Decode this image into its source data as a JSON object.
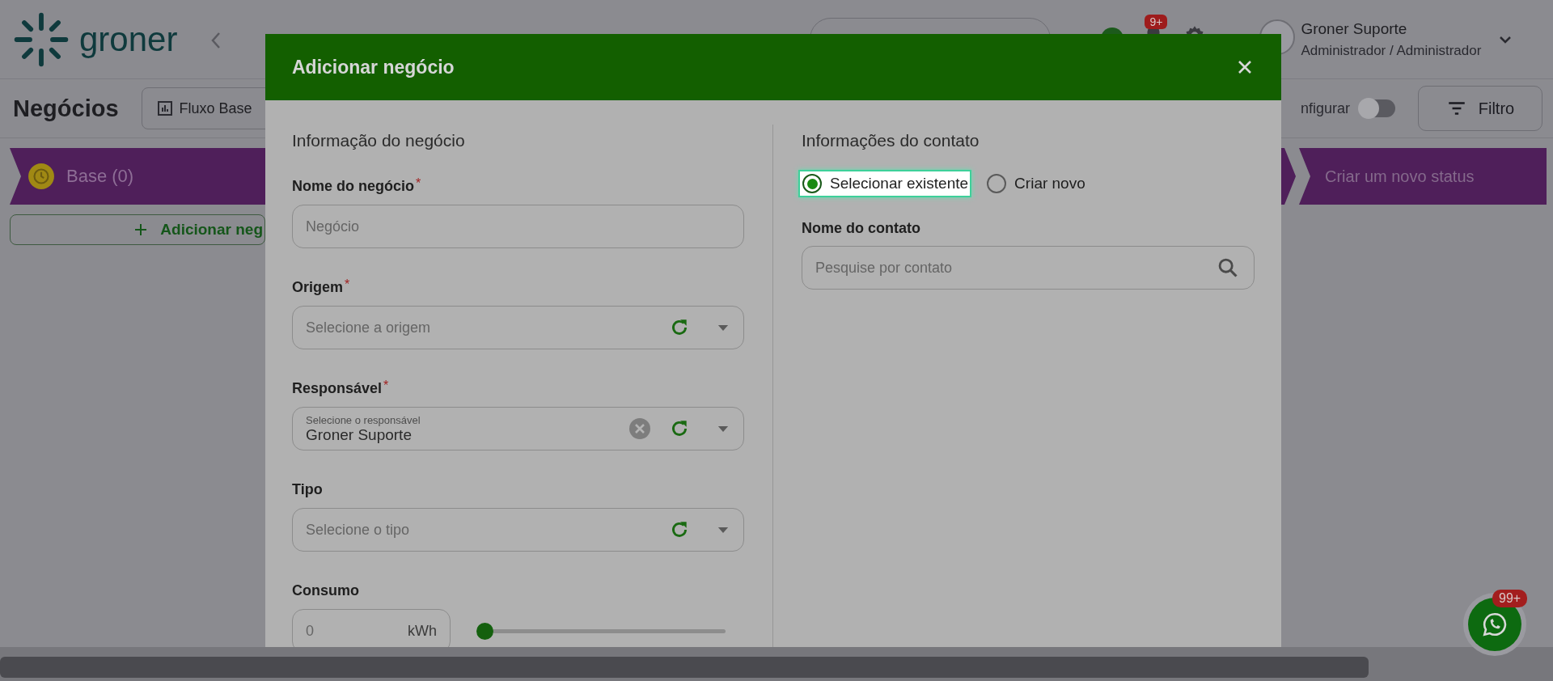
{
  "header": {
    "logo": "groner",
    "notifications_badge": "9+",
    "user": {
      "name": "Groner Suporte",
      "role": "Administrador / Administrador"
    }
  },
  "toolbar": {
    "title": "Negócios",
    "flow_button": "Fluxo Base",
    "configure_label": "nfigurar",
    "configure_on": false,
    "filter_button": "Filtro"
  },
  "board": {
    "statuses": [
      {
        "label": "Base (0)"
      }
    ],
    "add_button": "Adicionar neg",
    "new_status": "Criar um novo status"
  },
  "modal": {
    "title": "Adicionar negócio",
    "left": {
      "title": "Informação do negócio",
      "fields": [
        {
          "kind": "text",
          "label": "Nome do negócio",
          "required_mark": "*",
          "placeholder": "Negócio"
        },
        {
          "kind": "select",
          "label": "Origem",
          "required_mark": "*",
          "placeholder": "Selecione a origem"
        },
        {
          "kind": "select",
          "label": "Responsável",
          "required_mark": "*",
          "placeholder": "Selecione o responsável",
          "value": "Groner Suporte",
          "clearable": true
        },
        {
          "kind": "select",
          "label": "Tipo",
          "placeholder": "Selecione o tipo"
        },
        {
          "kind": "range",
          "label": "Consumo",
          "value": "0",
          "unit": "kWh",
          "level": 0
        }
      ]
    },
    "right": {
      "title": "Informações do contato",
      "options": [
        {
          "label": "Selecionar existente",
          "selected": true,
          "focused": true
        },
        {
          "label": "Criar novo",
          "selected": false,
          "focused": false
        }
      ],
      "field": {
        "label": "Nome do contato",
        "placeholder": "Pesquise por contato"
      }
    }
  },
  "chat": {
    "badge": "99+"
  }
}
